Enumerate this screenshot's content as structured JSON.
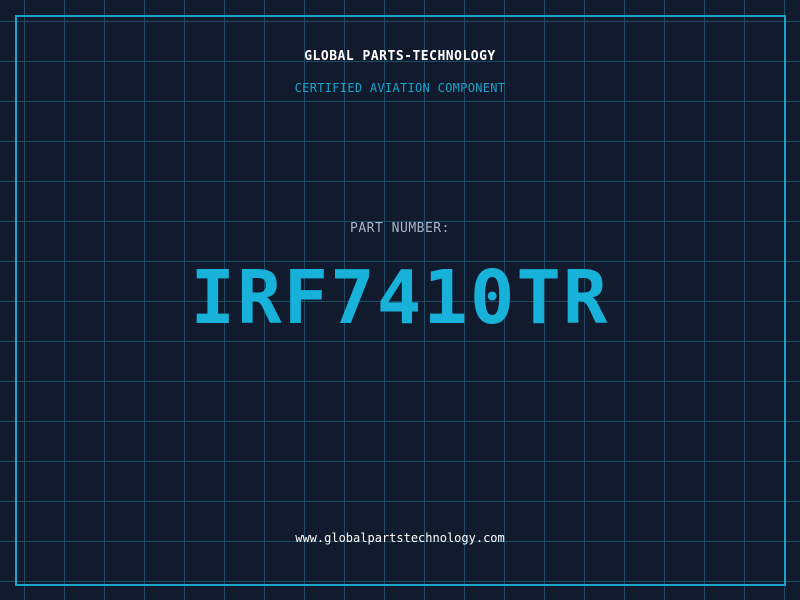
{
  "header": {
    "company": "GLOBAL PARTS-TECHNOLOGY",
    "subtitle": "CERTIFIED AVIATION COMPONENT"
  },
  "part": {
    "label": "PART NUMBER:",
    "number": "IRF7410TR"
  },
  "footer": {
    "website": "www.globalpartstechnology.com"
  },
  "colors": {
    "background": "#121a2e",
    "grid": "#1f4a63",
    "accent": "#1aa3cc",
    "text": "#ffffff"
  }
}
